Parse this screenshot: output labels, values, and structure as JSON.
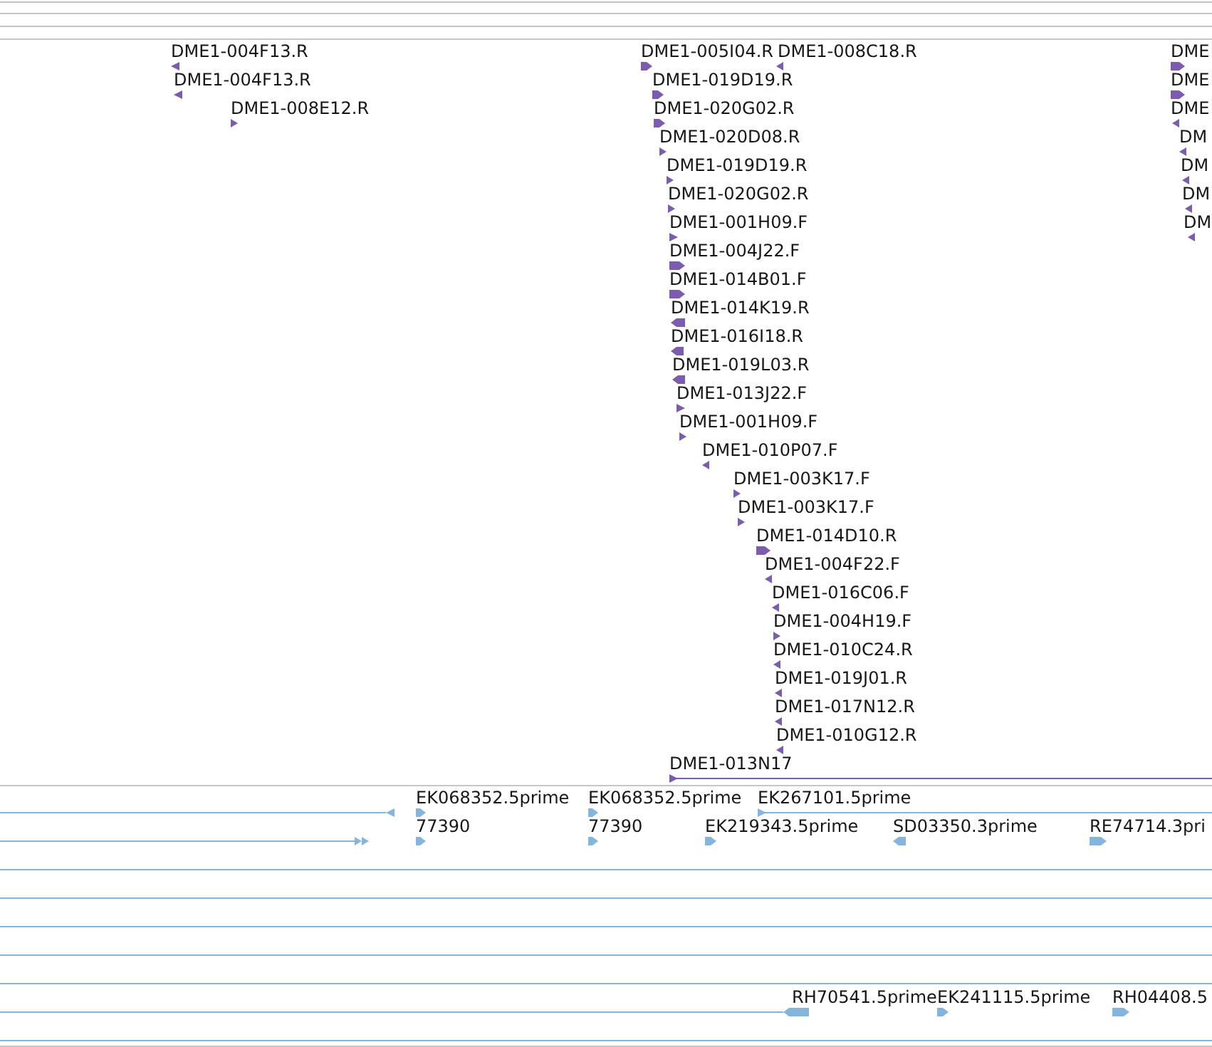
{
  "tracks": [
    {
      "color": "#7b5caf",
      "features": [
        {
          "kind": "arrow",
          "reverse": true,
          "label": "DME1-004F13.R"
        },
        {
          "kind": "arrow",
          "reverse": false,
          "label": "DME1-005I04.R"
        },
        {
          "kind": "arrow",
          "reverse": true,
          "label": "DME1-008C18.R"
        },
        {
          "kind": "arrow",
          "reverse": false,
          "label": "DME"
        },
        {
          "kind": "arrow",
          "reverse": true,
          "label": "DME1-004F13.R"
        },
        {
          "kind": "arrow",
          "reverse": false,
          "label": "DME1-019D19.R"
        },
        {
          "kind": "arrow",
          "reverse": false,
          "label": "DME"
        },
        {
          "kind": "arrow",
          "reverse": false,
          "label": "DME1-008E12.R"
        },
        {
          "kind": "arrow",
          "reverse": false,
          "label": "DME1-020G02.R"
        },
        {
          "kind": "arrow",
          "reverse": true,
          "label": "DME"
        },
        {
          "kind": "arrow",
          "reverse": false,
          "label": "DME1-020D08.R"
        },
        {
          "kind": "arrow",
          "reverse": true,
          "label": "DM"
        },
        {
          "kind": "arrow",
          "reverse": false,
          "label": "DME1-019D19.R"
        },
        {
          "kind": "arrow",
          "reverse": true,
          "label": "DM"
        },
        {
          "kind": "arrow",
          "reverse": false,
          "label": "DME1-020G02.R"
        },
        {
          "kind": "arrow",
          "reverse": true,
          "label": "DM"
        },
        {
          "kind": "arrow",
          "reverse": false,
          "label": "DME1-001H09.F"
        },
        {
          "kind": "arrow",
          "reverse": true,
          "label": "DM"
        },
        {
          "kind": "arrow",
          "reverse": false,
          "label": "DME1-004J22.F"
        },
        {
          "kind": "arrow",
          "reverse": false,
          "label": "DME1-014B01.F"
        },
        {
          "kind": "arrow",
          "reverse": true,
          "label": "DME1-014K19.R"
        },
        {
          "kind": "arrow",
          "reverse": true,
          "label": "DME1-016I18.R"
        },
        {
          "kind": "arrow",
          "reverse": true,
          "label": "DME1-019L03.R"
        },
        {
          "kind": "arrow",
          "reverse": false,
          "label": "DME1-013J22.F"
        },
        {
          "kind": "arrow",
          "reverse": false,
          "label": "DME1-001H09.F"
        },
        {
          "kind": "arrow",
          "reverse": true,
          "label": "DME1-010P07.F"
        },
        {
          "kind": "arrow",
          "reverse": false,
          "label": "DME1-003K17.F"
        },
        {
          "kind": "arrow",
          "reverse": false,
          "label": "DME1-003K17.F"
        },
        {
          "kind": "arrow",
          "reverse": false,
          "label": "DME1-014D10.R"
        },
        {
          "kind": "arrow",
          "reverse": true,
          "label": "DME1-004F22.F"
        },
        {
          "kind": "arrow",
          "reverse": true,
          "label": "DME1-016C06.F"
        },
        {
          "kind": "arrow",
          "reverse": false,
          "label": "DME1-004H19.F"
        },
        {
          "kind": "arrow",
          "reverse": true,
          "label": "DME1-010C24.R"
        },
        {
          "kind": "arrow",
          "reverse": true,
          "label": "DME1-019J01.R"
        },
        {
          "kind": "arrow",
          "reverse": true,
          "label": "DME1-017N12.R"
        },
        {
          "kind": "arrow",
          "reverse": true,
          "label": "DME1-010G12.R"
        },
        {
          "kind": "to_right",
          "reverse": false,
          "label": "DME1-013N17"
        }
      ]
    },
    {
      "color": "#85b5dd",
      "features": [
        {
          "kind": "from_left",
          "reverse": true
        },
        {
          "kind": "arrow",
          "reverse": false,
          "label": "EK068352.5prime"
        },
        {
          "kind": "arrow",
          "reverse": false,
          "label": "EK068352.5prime"
        },
        {
          "kind": "to_right",
          "reverse": false,
          "label": "EK267101.5prime"
        },
        {
          "kind": "from_left",
          "reverse": false
        },
        {
          "kind": "arrow",
          "reverse": false,
          "label": "77390"
        },
        {
          "kind": "arrow",
          "reverse": false,
          "label": "77390"
        },
        {
          "kind": "arrow",
          "reverse": false,
          "label": "EK219343.5prime"
        },
        {
          "kind": "arrow",
          "reverse": true,
          "label": "SD03350.3prime"
        },
        {
          "kind": "arrow",
          "reverse": false,
          "label": "RE74714.3pri"
        },
        {
          "kind": "span"
        },
        {
          "kind": "span"
        },
        {
          "kind": "span"
        },
        {
          "kind": "span"
        },
        {
          "kind": "span"
        },
        {
          "kind": "from_left",
          "reverse": true,
          "label": "RH70541.5prime"
        },
        {
          "kind": "arrow",
          "reverse": false,
          "label": "EK241115.5prime"
        },
        {
          "kind": "arrow",
          "reverse": false,
          "label": "RH04408.5"
        },
        {
          "kind": "span"
        }
      ]
    }
  ]
}
